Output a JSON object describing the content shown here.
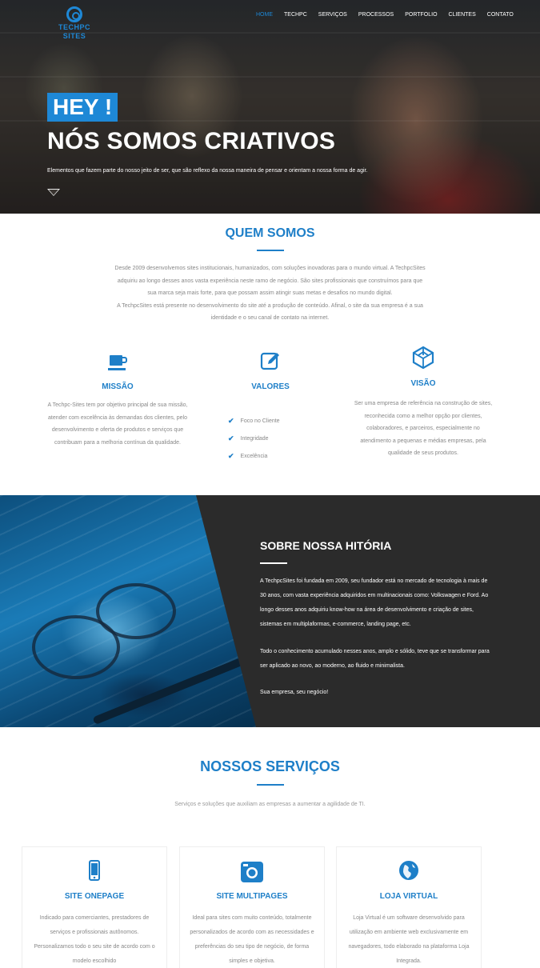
{
  "brand": {
    "logo_line1": "TECHPC",
    "logo_line2": "SITES",
    "accent": "#1e88d6"
  },
  "nav": {
    "items": [
      {
        "label": "HOME",
        "active": true
      },
      {
        "label": "TECHPC"
      },
      {
        "label": "SERVIÇOS"
      },
      {
        "label": "PROCESSOS"
      },
      {
        "label": "PORTFOLIO"
      },
      {
        "label": "CLIENTES"
      },
      {
        "label": "CONTATO"
      }
    ]
  },
  "hero": {
    "badge": "HEY !",
    "title": "NÓS SOMOS CRIATIVOS",
    "subtitle": "Elementos que fazem parte do nosso jeito de ser, que são reflexo da nossa maneira de pensar e orientam a nossa forma de agir."
  },
  "about": {
    "title": "QUEM SOMOS",
    "lines": [
      "Desde 2009 desenvolvemos sites institucionais, humanizados, com soluções inovadoras para o mundo virtual. A TechpcSites",
      "adquiriu ao longo desses anos vasta experiência neste ramo de negócio. São sites profissionais que construímos para que",
      "sua marca seja mais forte, para que possam assim atingir suas metas e desafios no mundo digital.",
      "A TechpcSites está presente no desenvolvimento do site até a produção de conteúdo. Afinal, o site da sua empresa é a sua",
      "identidade e o seu canal de contato na internet."
    ]
  },
  "features": {
    "missao": {
      "title": "MISSÃO",
      "lines": [
        "A Techpc-Sites tem por objetivo principal de sua missão,",
        "atender com excelência às demandas dos clientes, pelo",
        "desenvolvimento e oferta de produtos e serviços que",
        "contribuam para a melhoria contínua da qualidade."
      ]
    },
    "valores": {
      "title": "VALORES",
      "items": [
        "Foco no Cliente",
        "Integridade",
        "Excelência"
      ]
    },
    "visao": {
      "title": "VISÃO",
      "lines": [
        "Ser uma empresa de referência na construção de sites,",
        "reconhecida como a melhor opção por clientes,",
        "colaboradores, e parceiros, especialmente no",
        "atendimento a pequenas e médias empresas, pela",
        "qualidade de seus produtos."
      ]
    }
  },
  "history": {
    "title": "SOBRE NOSSA HITÓRIA",
    "p1": "A TechpcSites foi fundada em 2009, seu fundador está no mercado de tecnologia à mais de 30 anos, com vasta experiência adquiridos em multinacionais como: Volkswagen e Ford. Ao longo desses anos adquiriu know-how na área de desenvolvimento e criação de sites, sistemas em multiplaformas, e-commerce, landing page, etc.",
    "p2": "Todo o conhecimento acumulado nesses anos, amplo e sólido, teve que se transformar para ser aplicado ao novo, ao moderno, ao fluido e minimalista.",
    "p3": "Sua empresa, seu negócio!"
  },
  "services": {
    "title": "NOSSOS SERVIÇOS",
    "intro": "Serviços e soluções que auxiliam as empresas a aumentar a agilidade de TI.",
    "cards": [
      {
        "title": "SITE ONEPAGE",
        "icon": "mobile-phone-icon",
        "lines": [
          "Indicado para comerciantes, prestadores de",
          "serviços e profissionais autônomos.",
          "Personalizamos todo o seu site de acordo com o",
          "modelo escolhido"
        ]
      },
      {
        "title": "SITE MULTIPAGES",
        "icon": "camera-icon",
        "lines": [
          "Ideal para sites com muito conteúdo, totalmente",
          "personalizados de acordo com as necessidades e",
          "preferências do seu tipo de negócio, de forma",
          "simples e objetiva."
        ]
      },
      {
        "title": "LOJA VIRTUAL",
        "icon": "globe-icon",
        "lines": [
          "Loja Virtual é um software desenvolvido para",
          "utilização em ambiente web exclusivamente em",
          "navegadores, todo elaborado na plataforma Loja",
          "Integrada."
        ]
      }
    ]
  }
}
